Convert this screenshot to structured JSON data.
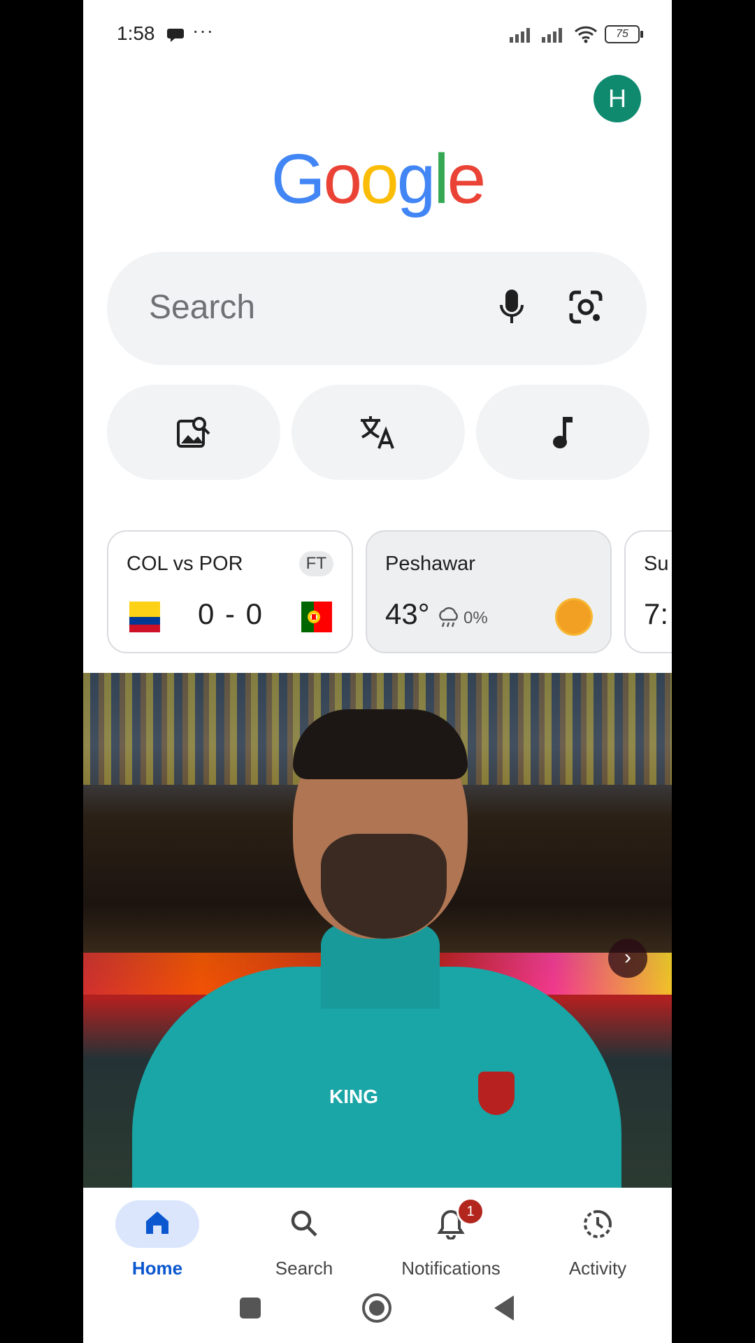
{
  "status": {
    "time": "1:58",
    "dots": "···",
    "battery": "75"
  },
  "account": {
    "initial": "H"
  },
  "logo": {
    "letters": [
      "G",
      "o",
      "o",
      "g",
      "l",
      "e"
    ],
    "colors": [
      "#4285F4",
      "#EA4335",
      "#FBBC05",
      "#4285F4",
      "#34A853",
      "#EA4335"
    ]
  },
  "search": {
    "placeholder": "Search"
  },
  "chips": [
    "image-search-icon",
    "translate-icon",
    "music-note-icon"
  ],
  "cards": {
    "match": {
      "title": "COL vs POR",
      "status": "FT",
      "score": "0 - 0"
    },
    "weather": {
      "city": "Peshawar",
      "temp": "43°",
      "precip": "0%"
    },
    "partial": {
      "title": "Su",
      "value": "7:"
    }
  },
  "hero": {
    "brand": "KING"
  },
  "nav": {
    "home": "Home",
    "search": "Search",
    "notifications": "Notifications",
    "notifications_badge": "1",
    "activity": "Activity"
  },
  "colors": {
    "accent": "#0b57d0",
    "avatar": "#0f8a6f",
    "badge": "#b3261e"
  }
}
